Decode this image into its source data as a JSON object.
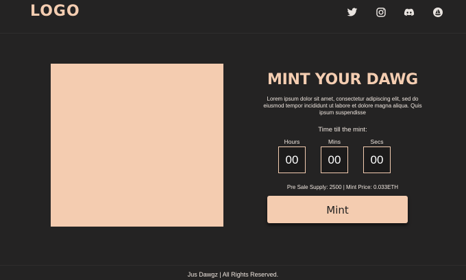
{
  "header": {
    "logo_text": "LOGO",
    "socials": [
      {
        "icon": "twitter-icon",
        "name": "Twitter"
      },
      {
        "icon": "instagram-icon",
        "name": "Instagram"
      },
      {
        "icon": "discord-icon",
        "name": "Discord"
      },
      {
        "icon": "opensea-icon",
        "name": "OpenSea"
      }
    ]
  },
  "mint": {
    "title": "MINT YOUR DAWG",
    "description": "Lorem ipsum dolor sit amet, consectetur adipiscing elit, sed do eiusmod tempor incididunt ut labore et dolore magna aliqua. Quis ipsum suspendisse",
    "timer_label": "Time till the mint:",
    "countdown": [
      {
        "label": "Hours",
        "value": "00"
      },
      {
        "label": "Mins",
        "value": "00"
      },
      {
        "label": "Secs",
        "value": "00"
      }
    ],
    "supply_text": "Pre Sale Supply: 2500 | Mint Price: 0.033ETH",
    "button_label": "Mint"
  },
  "footer": {
    "text": "Jus Dawgz | All Rights Reserved."
  },
  "colors": {
    "background": "#242323",
    "accent": "#f4ccb0",
    "text_light": "#efe6df"
  }
}
